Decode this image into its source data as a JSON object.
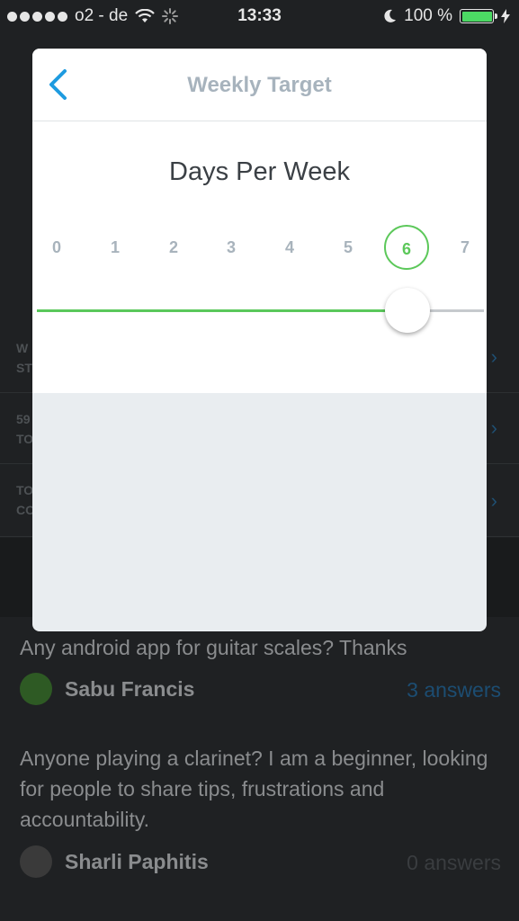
{
  "status_bar": {
    "carrier": "o2 - de",
    "time": "13:33",
    "battery_text": "100 %",
    "battery_level": 1.0,
    "icons": [
      "signal-dots-icon",
      "wifi-icon",
      "loading-spinner-icon",
      "moon-icon",
      "battery-icon",
      "charging-bolt-icon"
    ]
  },
  "modal": {
    "title": "Weekly Target",
    "back_icon": "chevron-left-icon",
    "section_title": "Days Per Week",
    "day_options": [
      "0",
      "1",
      "2",
      "3",
      "4",
      "5",
      "6",
      "7"
    ],
    "selected_day": 6,
    "slider_value": 6,
    "slider_max": 7
  },
  "background": {
    "posts": [
      {
        "question": "Any android app for guitar scales? Thanks",
        "author": "Sabu Francis",
        "answers": "3 answers"
      },
      {
        "question": "Anyone playing a clarinet? I am a beginner, looking for people to share tips, frustrations and accountability.",
        "author": "Sharli Paphitis",
        "answers": "0 answers"
      }
    ]
  },
  "colors": {
    "accent_blue": "#1e9be0",
    "accent_green": "#5cc85a",
    "title_gray": "#a7b3bd",
    "text_dark": "#3b4045",
    "modal_lower_bg": "#e9edf0",
    "overlay": "#1f2123"
  }
}
